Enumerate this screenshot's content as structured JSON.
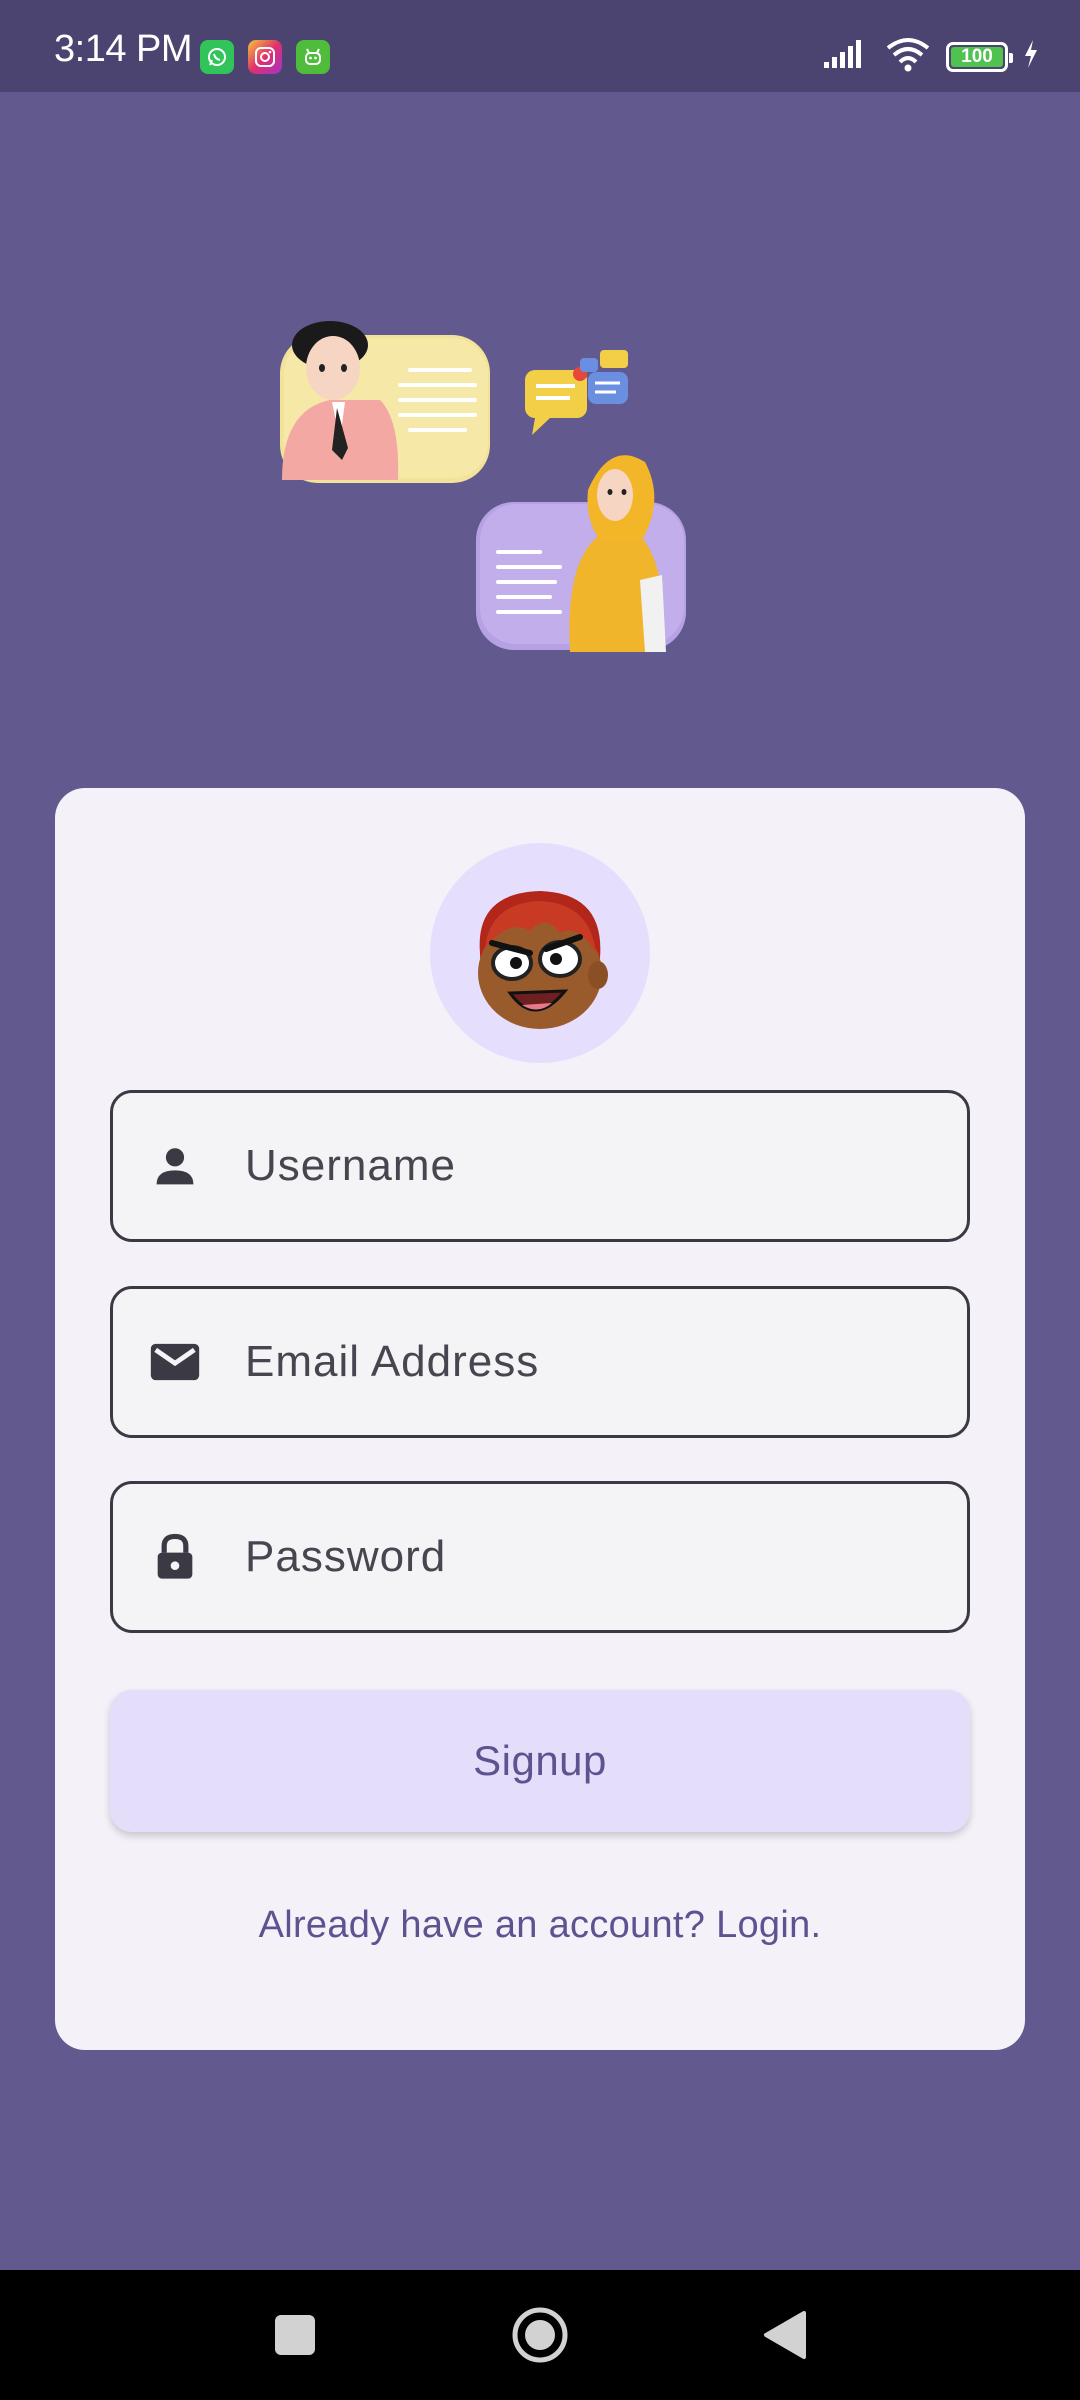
{
  "status_bar": {
    "time": "3:14 PM",
    "notification_icons": [
      "whatsapp-icon",
      "instagram-icon",
      "bot-icon"
    ],
    "battery_level": "100",
    "signal": "full",
    "wifi": "connected",
    "charging": true
  },
  "form": {
    "username_placeholder": "Username",
    "email_placeholder": "Email Address",
    "password_placeholder": "Password",
    "signup_label": "Signup",
    "login_link": "Already have an account? Login."
  },
  "colors": {
    "background": "#625a8e",
    "status_bar": "#4c4470",
    "card": "#f5f1f9",
    "accent": "#5e5390",
    "button": "#e5defb",
    "avatar_bg": "#e6defd"
  }
}
